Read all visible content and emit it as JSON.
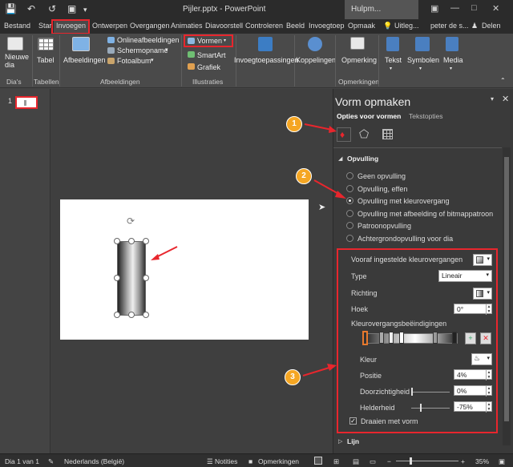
{
  "titlebar": {
    "title": "Pijler.pptx - PowerPoint",
    "context_tab": "Hulpm..."
  },
  "tabs": [
    "Bestand",
    "Start",
    "Invoegen",
    "Ontwerpen",
    "Overgangen",
    "Animaties",
    "Diavoorstell",
    "Controleren",
    "Beeld",
    "Invoegtoep",
    "Opmaak"
  ],
  "tell_me": "Uitleg...",
  "user": "peter de s...",
  "share": "Delen",
  "ribbon": {
    "new_slide": "Nieuwe dia",
    "table": "Tabel",
    "images": "Afbeeldingen",
    "online_images": "Onlineafbeeldingen",
    "screenshot": "Schermopname",
    "photo_album": "Fotoalbum",
    "shapes": "Vormen",
    "smartart": "SmartArt",
    "chart": "Grafiek",
    "addins": "Invoegtoepassingen",
    "links": "Koppelingen",
    "comment": "Opmerking",
    "text": "Tekst",
    "symbols": "Symbolen",
    "media": "Media",
    "groups": {
      "slides": "Dia's",
      "tables": "Tabellen",
      "images": "Afbeeldingen",
      "illustrations": "Illustraties",
      "comments": "Opmerkingen"
    }
  },
  "thumbnail_number": "1",
  "pane": {
    "title": "Vorm opmaken",
    "tab_shape": "Opties voor vormen",
    "tab_text": "Tekstopties",
    "section_fill": "Opvulling",
    "fill_options": [
      "Geen opvulling",
      "Opvulling, effen",
      "Opvulling met kleurovergang",
      "Opvulling met afbeelding of bitmappatroon",
      "Patroonopvulling",
      "Achtergrondopvulling voor dia"
    ],
    "preset_label": "Vooraf ingestelde kleurovergangen",
    "type_label": "Type",
    "type_value": "Lineair",
    "direction_label": "Richting",
    "angle_label": "Hoek",
    "angle_value": "0°",
    "stops_label": "Kleurovergangsbeëindigingen",
    "color_label": "Kleur",
    "position_label": "Positie",
    "position_value": "4%",
    "transparency_label": "Doorzichtigheid",
    "transparency_value": "0%",
    "brightness_label": "Helderheid",
    "brightness_value": "-75%",
    "rotate_label": "Draaien met vorm",
    "section_line": "Lijn"
  },
  "badges": [
    "1",
    "2",
    "3"
  ],
  "status": {
    "slide": "Dia 1 van 1",
    "language": "Nederlands (België)",
    "notes": "Notities",
    "comments": "Opmerkingen",
    "zoom": "35%"
  },
  "colors": {
    "accent_red": "#e8262d",
    "badge": "#f5a623",
    "ribbon": "#4a4a4a",
    "titlebar": "#2b2b2b"
  }
}
